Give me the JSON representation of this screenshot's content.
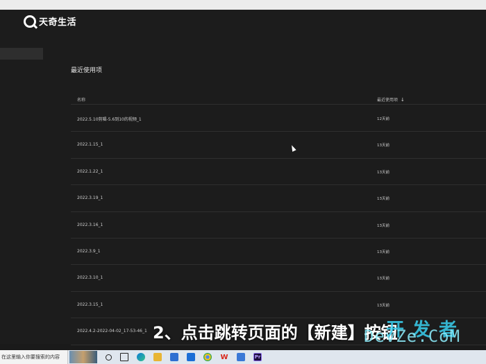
{
  "brand": {
    "name": "天奇生活"
  },
  "main": {
    "section_title": "最近使用项",
    "columns": {
      "name": "名称",
      "recent": "最近使用项",
      "sort_icon": "arrow-down-icon"
    },
    "rows": [
      {
        "name": "2022.5.10剪辑-5.6到10的视频_1",
        "time": "12天前"
      },
      {
        "name": "2022.1.15_1",
        "time": "13天前"
      },
      {
        "name": "2022.1.22_1",
        "time": "13天前"
      },
      {
        "name": "2022.3.19_1",
        "time": "13天前"
      },
      {
        "name": "2022.3.16_1",
        "time": "13天前"
      },
      {
        "name": "2022.3.9_1",
        "time": "13天前"
      },
      {
        "name": "2022.3.10_1",
        "time": "13天前"
      },
      {
        "name": "2022.3.15_1",
        "time": "13天前"
      },
      {
        "name": "2022.4.2-2022-04-02_17-53-46_1",
        "time": "13天前"
      }
    ]
  },
  "caption": "2、点击跳转页面的【新建】按钮",
  "watermark": {
    "line1": "开发者",
    "line2": "DevZe.CoM"
  },
  "taskbar": {
    "search_placeholder": "在这里输入你要搜索的内容",
    "icons": [
      "search-thumbnail",
      "cortana-icon",
      "task-view-icon",
      "edge-icon",
      "file-explorer-icon",
      "store-icon",
      "mail-icon",
      "chrome-icon",
      "wps-icon",
      "app-icon",
      "premiere-icon"
    ],
    "wps_label": "W",
    "premiere_label": "Pr"
  },
  "colors": {
    "background": "#1c1c1c",
    "taskbar": "#dfe6ee",
    "watermark": "#3ad0f0"
  }
}
